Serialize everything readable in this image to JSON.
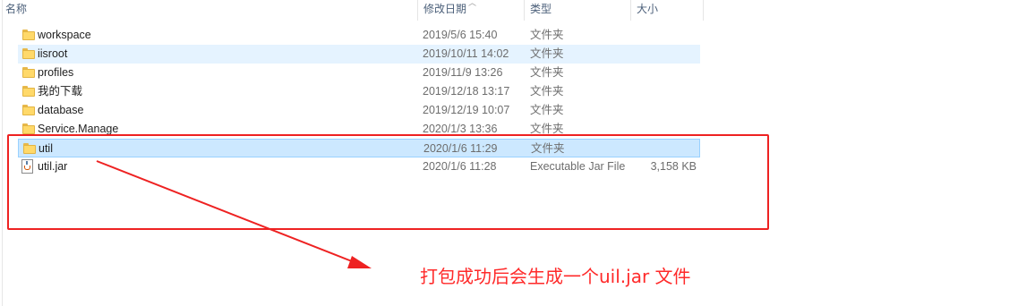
{
  "columns": {
    "name": "名称",
    "date_modified": "修改日期",
    "type": "类型",
    "size": "大小"
  },
  "files": [
    {
      "name": "workspace",
      "date": "2019/5/6 15:40",
      "type": "文件夹",
      "size": "",
      "icon": "folder-icon"
    },
    {
      "name": "iisroot",
      "date": "2019/10/11 14:02",
      "type": "文件夹",
      "size": "",
      "icon": "folder-icon"
    },
    {
      "name": "profiles",
      "date": "2019/11/9 13:26",
      "type": "文件夹",
      "size": "",
      "icon": "folder-icon"
    },
    {
      "name": "我的下载",
      "date": "2019/12/18 13:17",
      "type": "文件夹",
      "size": "",
      "icon": "folder-icon"
    },
    {
      "name": "database",
      "date": "2019/12/19 10:07",
      "type": "文件夹",
      "size": "",
      "icon": "folder-icon"
    },
    {
      "name": "Service.Manage",
      "date": "2020/1/3 13:36",
      "type": "文件夹",
      "size": "",
      "icon": "folder-icon"
    },
    {
      "name": "util",
      "date": "2020/1/6 11:29",
      "type": "文件夹",
      "size": "",
      "icon": "folder-icon"
    },
    {
      "name": "util.jar",
      "date": "2020/1/6 11:28",
      "type": "Executable Jar File",
      "size": "3,158 KB",
      "icon": "jar-file-icon"
    }
  ],
  "annotation": {
    "text": "打包成功后会生成一个uil.jar 文件",
    "color": "#ff2a2a"
  },
  "colors": {
    "selection": "#cce8ff",
    "hover": "#e5f3ff",
    "highlight_box": "#ee2222"
  }
}
